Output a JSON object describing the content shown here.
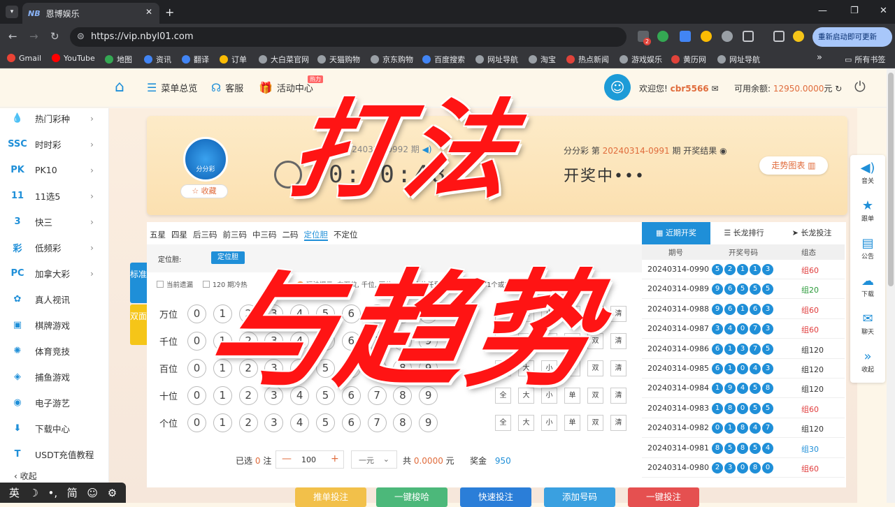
{
  "browser": {
    "tab_title": "恩博娱乐",
    "tab_favicon": "NB",
    "url": "https://vip.nbyl01.com",
    "update_btn": "重新启动即可更新",
    "ext_badge": "2",
    "bookmarks": [
      "Gmail",
      "YouTube",
      "地图",
      "资讯",
      "翻译",
      "订单",
      "大白菜官网",
      "天猫购物",
      "京东购物",
      "百度搜索",
      "网址导航",
      "淘宝",
      "热点新闻",
      "游戏娱乐",
      "黄历网",
      "网址导航"
    ],
    "all_bookmarks": "所有书签"
  },
  "header": {
    "nav": [
      "菜单总览",
      "客服",
      "活动中心"
    ],
    "hot_tag": "热力",
    "welcome": "欢迎您!",
    "username": "cbr5566",
    "balance_label": "可用余额:",
    "balance": "12950.0000",
    "balance_unit": "元"
  },
  "sidebar": {
    "items": [
      {
        "icon": "fire-icon",
        "glyph": "💧",
        "label": "热门彩种"
      },
      {
        "icon": "ssc-icon",
        "glyph": "SSC",
        "label": "时时彩"
      },
      {
        "icon": "pk-icon",
        "glyph": "PK",
        "label": "PK10"
      },
      {
        "icon": "11x5-icon",
        "glyph": "11",
        "label": "11选5"
      },
      {
        "icon": "k3-icon",
        "glyph": "3",
        "label": "快三"
      },
      {
        "icon": "lowfreq-icon",
        "glyph": "彩",
        "label": "低频彩"
      },
      {
        "icon": "pc-icon",
        "glyph": "PC",
        "label": "加拿大彩"
      },
      {
        "icon": "live-icon",
        "glyph": "✿",
        "label": "真人视讯"
      },
      {
        "icon": "cards-icon",
        "glyph": "▣",
        "label": "棋牌游戏"
      },
      {
        "icon": "sports-icon",
        "glyph": "✺",
        "label": "体育竞技"
      },
      {
        "icon": "fish-icon",
        "glyph": "◈",
        "label": "捕鱼游戏"
      },
      {
        "icon": "egame-icon",
        "glyph": "◉",
        "label": "电子游艺"
      },
      {
        "icon": "download-icon",
        "glyph": "⬇",
        "label": "下载中心"
      },
      {
        "icon": "usdt-icon",
        "glyph": "T",
        "label": "USDT充值教程"
      }
    ],
    "collapse": "收起"
  },
  "banner": {
    "logo_text": "分分彩",
    "favorite": "☆ 收藏",
    "current_issue": "20240314-0992 期",
    "timer": "0:00:48",
    "last_label": "分分彩 第",
    "last_issue": "20240314-0991",
    "last_suffix": "期 开奖结果",
    "drawing": "开奖中•••",
    "trend_btn": "走势图表"
  },
  "play": {
    "tabs": [
      "五星",
      "四星",
      "后三码",
      "前三码",
      "中三码",
      "二码",
      "定位胆",
      "不定位"
    ],
    "active_tab": "定位胆",
    "sub_label": "定位胆:",
    "sub_btn": "定位胆",
    "opt1": "当前遗漏",
    "opt2": "120 期冷热",
    "hint": "玩法提示: 在万位, 千位, 百位, 十位, 个位任意位置上任意选择1个或1个以上号码",
    "example": "例子",
    "mode_std": "标准",
    "mode_double": "双面",
    "rows": [
      "万位",
      "千位",
      "百位",
      "十位",
      "个位"
    ],
    "digits": [
      "0",
      "1",
      "2",
      "3",
      "4",
      "5",
      "6",
      "7",
      "8",
      "9"
    ],
    "quick": [
      "全",
      "大",
      "小",
      "单",
      "双",
      "清"
    ]
  },
  "bottom": {
    "selected_label": "已选",
    "selected": "0",
    "selected_unit": "注",
    "multiplier": "100",
    "unit": "一元",
    "total_label": "共",
    "total": "0.0000",
    "total_unit": "元",
    "prize_label": "奖金",
    "prize": "950",
    "buttons": [
      "一键投注",
      "添加号码",
      "快速投注",
      "一键梭哈",
      "推单投注"
    ]
  },
  "history": {
    "tabs": [
      "近期开奖",
      "长龙排行",
      "长龙投注"
    ],
    "headers": [
      "期号",
      "开奖号码",
      "组态"
    ],
    "rows": [
      {
        "issue": "20240314-0990",
        "nums": [
          "5",
          "2",
          "1",
          "1",
          "3"
        ],
        "state": "组60",
        "color": "#e03c3c"
      },
      {
        "issue": "20240314-0989",
        "nums": [
          "9",
          "6",
          "5",
          "5",
          "5"
        ],
        "state": "组20",
        "color": "#2a9a3a"
      },
      {
        "issue": "20240314-0988",
        "nums": [
          "9",
          "6",
          "1",
          "6",
          "3"
        ],
        "state": "组60",
        "color": "#e03c3c"
      },
      {
        "issue": "20240314-0987",
        "nums": [
          "3",
          "4",
          "0",
          "7",
          "3"
        ],
        "state": "组60",
        "color": "#e03c3c"
      },
      {
        "issue": "20240314-0986",
        "nums": [
          "6",
          "1",
          "3",
          "7",
          "5"
        ],
        "state": "组120",
        "color": "#333333"
      },
      {
        "issue": "20240314-0985",
        "nums": [
          "6",
          "1",
          "0",
          "4",
          "3"
        ],
        "state": "组120",
        "color": "#333333"
      },
      {
        "issue": "20240314-0984",
        "nums": [
          "1",
          "9",
          "4",
          "5",
          "8"
        ],
        "state": "组120",
        "color": "#333333"
      },
      {
        "issue": "20240314-0983",
        "nums": [
          "1",
          "8",
          "0",
          "5",
          "5"
        ],
        "state": "组60",
        "color": "#e03c3c"
      },
      {
        "issue": "20240314-0982",
        "nums": [
          "0",
          "1",
          "8",
          "4",
          "7"
        ],
        "state": "组120",
        "color": "#333333"
      },
      {
        "issue": "20240314-0981",
        "nums": [
          "8",
          "5",
          "8",
          "5",
          "4"
        ],
        "state": "组30",
        "color": "#1f8fd8"
      },
      {
        "issue": "20240314-0980",
        "nums": [
          "2",
          "3",
          "0",
          "8",
          "0"
        ],
        "state": "组60",
        "color": "#e03c3c"
      }
    ]
  },
  "floatbar": [
    "音关",
    "跟单",
    "公告",
    "下载",
    "聊天",
    "收起"
  ],
  "ime": [
    "英",
    "☽",
    "•,",
    "简",
    "☺",
    "⚙"
  ],
  "overlay": {
    "line1": "打法",
    "line2": "与趋势"
  }
}
